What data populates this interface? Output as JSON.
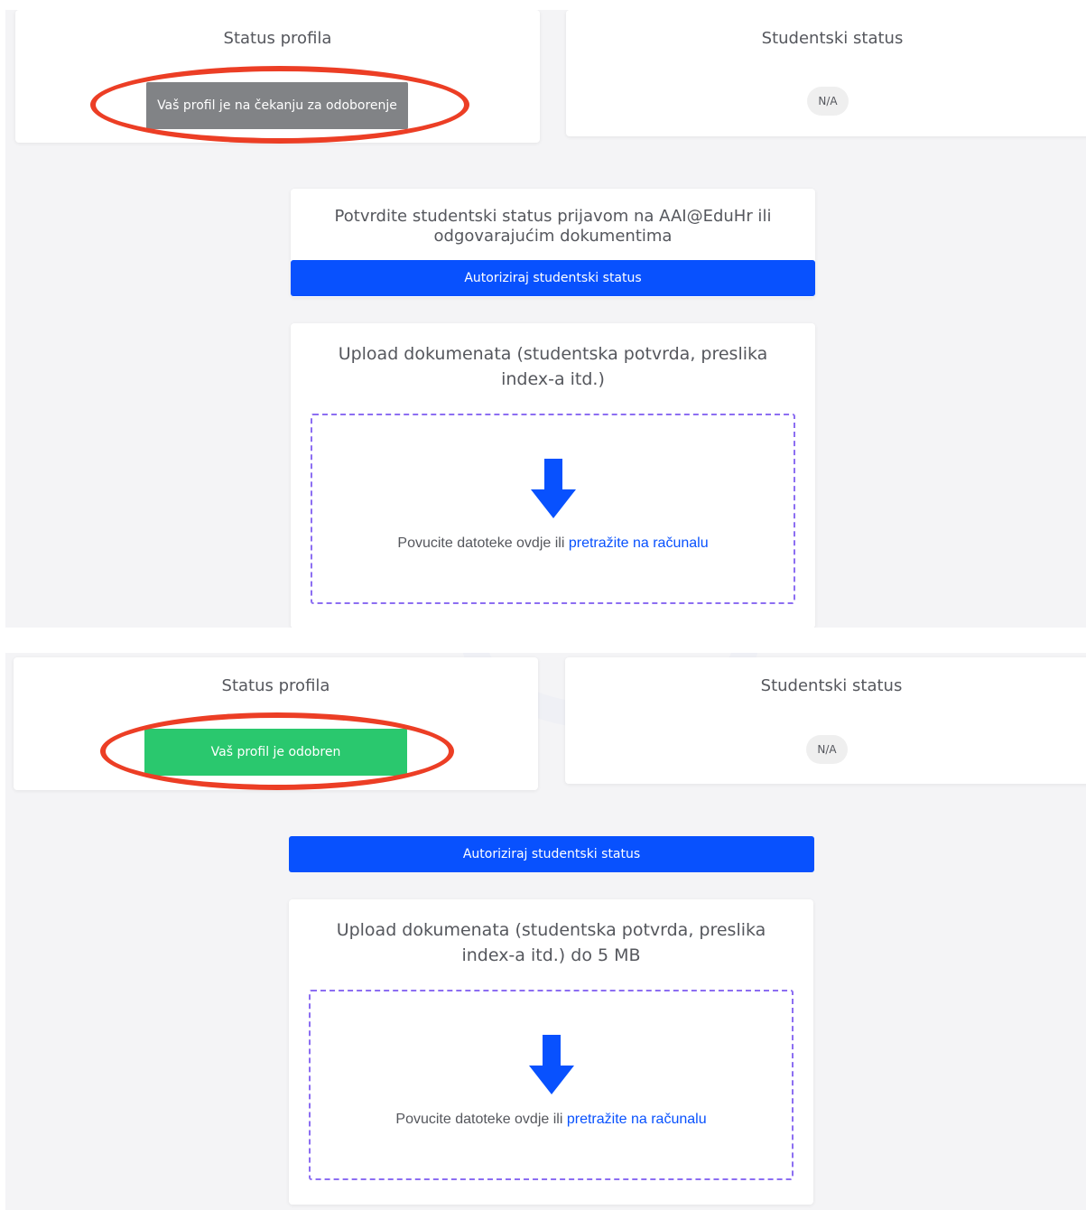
{
  "colors": {
    "pending_button": "#818386",
    "approved_button": "#2ac86e",
    "primary_blue": "#0851fe",
    "highlight_ellipse": "#ec3e25",
    "dropzone_border": "#8c6ef2"
  },
  "top": {
    "status_card": {
      "title": "Status profila",
      "status_label": "Vaš profil je na čekanju za odoborenje"
    },
    "student_card": {
      "title": "Studentski status",
      "badge": "N/A"
    },
    "confirm_card": {
      "title": "Potvrdite studentski status prijavom na AAI@EduHr ili odgovarajućim dokumentima"
    },
    "authorize_button": "Autoriziraj studentski status",
    "upload_card": {
      "title": "Upload dokumenata (studentska potvrda, preslika index-a itd.)",
      "drop_text": "Povucite datoteke ovdje ili",
      "browse_link": "pretražite na računalu",
      "icon": "arrow-down-icon"
    }
  },
  "bottom": {
    "status_card": {
      "title": "Status profila",
      "status_label": "Vaš profil je odobren"
    },
    "student_card": {
      "title": "Studentski status",
      "badge": "N/A"
    },
    "authorize_button": "Autoriziraj studentski status",
    "upload_card": {
      "title": "Upload dokumenata (studentska potvrda, preslika index-a itd.) do 5 MB",
      "drop_text": "Povucite datoteke ovdje ili",
      "browse_link": "pretražite na računalu",
      "icon": "arrow-down-icon"
    }
  }
}
